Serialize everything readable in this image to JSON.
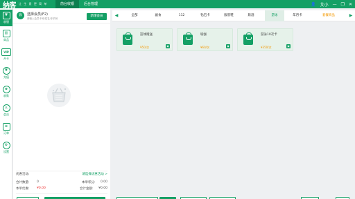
{
  "app": {
    "logo": "纳客",
    "logo_subtitle": "让 生 意 更 简 单",
    "top_tabs": [
      "前台收银",
      "后台管理"
    ],
    "user_name": "艾小",
    "window_controls": [
      "minimize-icon",
      "restore-icon",
      "close-icon"
    ]
  },
  "leftnav": [
    {
      "label": "收银",
      "icon": "cashier-icon"
    },
    {
      "label": "商品",
      "icon": "goods-icon"
    },
    {
      "label": "开卡",
      "icon": "vip-card-icon"
    },
    {
      "label": "充值",
      "icon": "recharge-icon"
    },
    {
      "label": "收款",
      "icon": "collect-icon"
    },
    {
      "label": "会员",
      "icon": "member-icon"
    },
    {
      "label": "订单",
      "icon": "order-icon"
    },
    {
      "label": "设置",
      "icon": "settings-icon"
    }
  ],
  "member": {
    "name": "选择会员(F2)",
    "hint": "请输入会员卡号/姓名/手机号",
    "new_member_label": "新增会员"
  },
  "summary": {
    "promo_label": "优惠活动:",
    "promo_link": "请选择优惠活动 >",
    "total_qty_label": "合计数量:",
    "total_qty": "0",
    "points_label": "本单积分:",
    "points": "0.00",
    "discount_label": "本单优惠:",
    "discount": "¥0.00",
    "total_amount_label": "合计金额:",
    "total_amount": "¥0.00"
  },
  "categories": {
    "tabs": [
      "全部",
      "副食",
      "112",
      "钻石卡",
      "服装鞋",
      "默酒",
      "游泳",
      "年月卡",
      "套餐商品"
    ],
    "active_index": 6,
    "highlight_color": "#f39800"
  },
  "products": [
    {
      "name": "篮球赠送",
      "price": "¥50/次"
    },
    {
      "name": "瑜伽",
      "price": "¥60/次"
    },
    {
      "name": "游泳10次卡",
      "price": "¥350/次"
    }
  ],
  "colors": {
    "brand": "#14a065",
    "brand_dark": "#0c7f4f",
    "price": "#f39800",
    "negative": "#ee3333"
  }
}
